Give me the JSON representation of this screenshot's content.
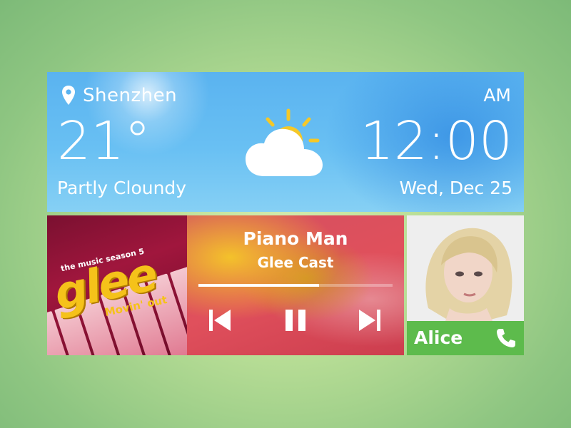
{
  "weather": {
    "location": "Shenzhen",
    "temperature": "21°",
    "condition": "Partly Cloundy",
    "icon": "partly-cloudy-icon"
  },
  "clock": {
    "ampm": "AM",
    "time": "12:00",
    "date": "Wed, Dec 25"
  },
  "album": {
    "top_text": "the music season 5",
    "logo": "glee",
    "subtitle": "Movin' out"
  },
  "player": {
    "song": "Piano Man",
    "artist": "Glee Cast",
    "progress": 0.62,
    "controls": [
      "previous-icon",
      "pause-icon",
      "next-icon"
    ]
  },
  "contact": {
    "name": "Alice",
    "call_icon": "phone-icon"
  },
  "colors": {
    "weather_sky": "#5ab3f0",
    "contact_bar": "#5dbb4c",
    "sun": "#f5c828",
    "player_red": "#e0505c"
  }
}
